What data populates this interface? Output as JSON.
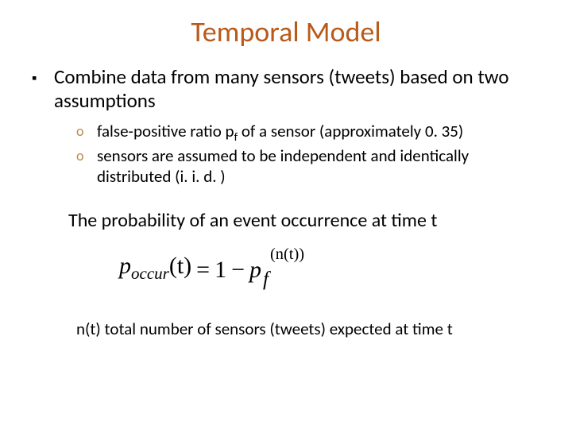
{
  "title": "Temporal Model",
  "bullet": {
    "marker": "▪",
    "text": "Combine data from many sensors (tweets) based on two assumptions"
  },
  "sub": [
    {
      "marker": "o",
      "html": "false-positive ratio p<sub>f</sub> of a sensor (approximately 0. 35)"
    },
    {
      "marker": "o",
      "html": "sensors are assumed to be independent and identically distributed (i. i. d. )"
    }
  ],
  "prob_line": "The probability of an event occurrence at time t",
  "formula": {
    "lhs_p": "p",
    "lhs_sub": "occur",
    "lhs_arg": "(t)",
    "eq": "=",
    "rhs_one": "1",
    "rhs_minus": "−",
    "rhs_p": "p",
    "rhs_sub": "f",
    "rhs_sup": "(n(t))"
  },
  "caption": "n(t) total number of sensors (tweets) expected at time t"
}
